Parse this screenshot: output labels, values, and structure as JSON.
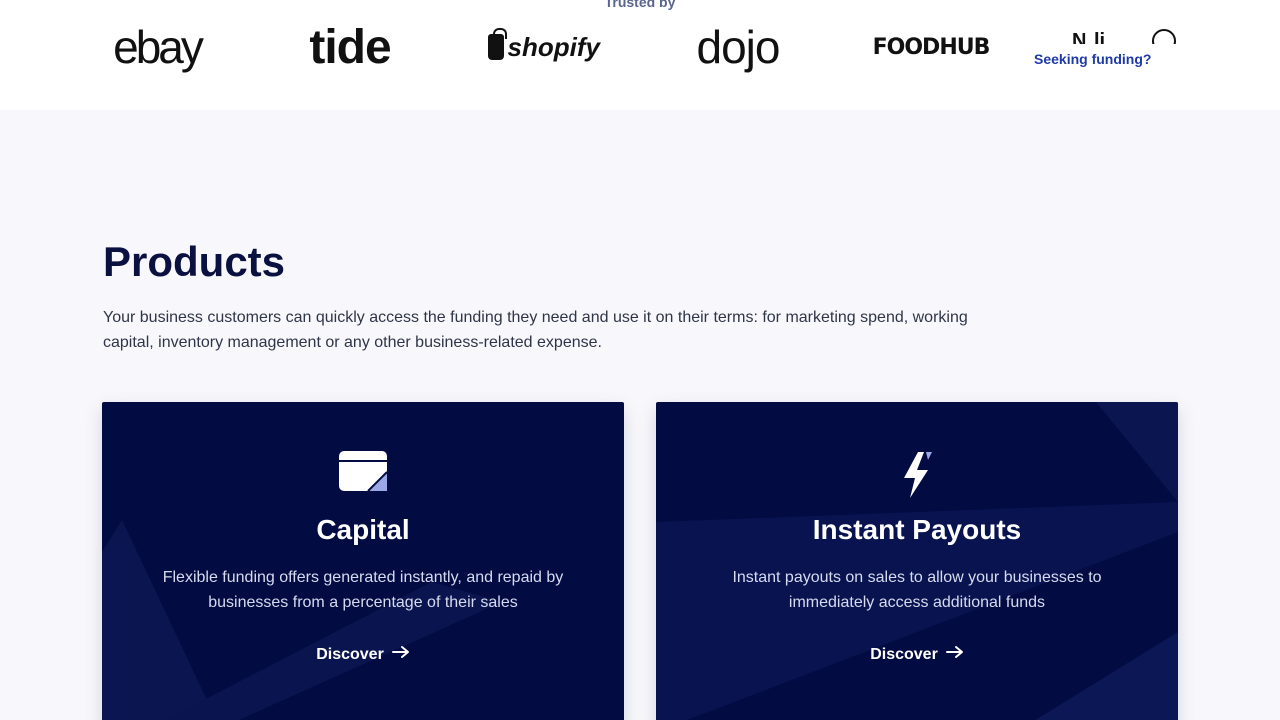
{
  "trusted": {
    "label": "Trusted by"
  },
  "logos": {
    "ebay": "ebay",
    "tide": "tide",
    "shopify": "shopify",
    "dojo": "dojo",
    "foodhub": "FOODHUB"
  },
  "nav": {
    "seeking_funding": "Seeking funding?"
  },
  "products": {
    "title": "Products",
    "description": "Your business customers can quickly access the funding they need and use it on their terms: for marketing spend, working capital, inventory management or any other business-related expense.",
    "cards": [
      {
        "icon": "card-icon",
        "title": "Capital",
        "description": "Flexible funding offers generated instantly, and repaid by businesses from a percentage of their sales",
        "link": "Discover"
      },
      {
        "icon": "lightning-icon",
        "title": "Instant Payouts",
        "description": "Instant payouts on sales to allow your businesses to immediately access additional funds",
        "link": "Discover"
      }
    ]
  },
  "colors": {
    "navy": "#020b42",
    "accent_blue": "#1e3aa8",
    "page_bg": "#f8f8fc",
    "icon_accent": "#9aa8e8"
  }
}
